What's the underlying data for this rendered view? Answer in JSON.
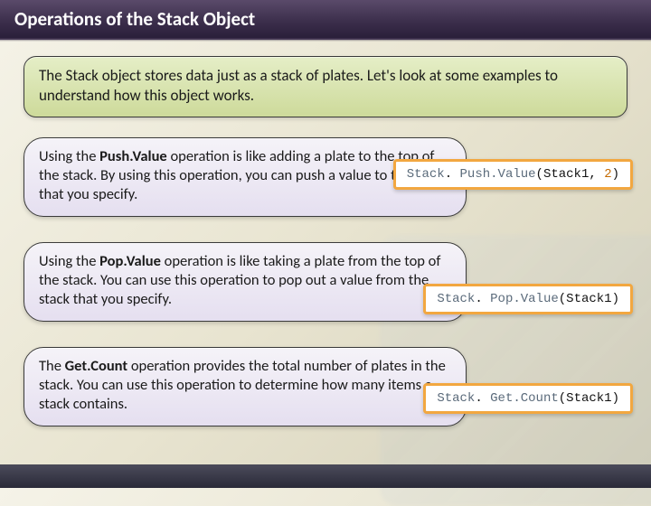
{
  "title": "Operations of the Stack Object",
  "intro": "The Stack object stores data just as a stack of plates. Let's look at some examples to understand how this object works.",
  "ops": [
    {
      "pre": "Using the ",
      "bold": "Push.Value",
      "post": " operation is like adding a plate to the top of the stack. By using this operation, you can push a value to the stack that you specify.",
      "code": {
        "cls": "Stack",
        "method": "Push.Value",
        "arg1": "Stack1",
        "arg2": "2"
      }
    },
    {
      "pre": "Using the ",
      "bold": "Pop.Value",
      "post": " operation is like taking a plate from the top of the stack. You can use this operation to pop out a value from the stack that you specify.",
      "code": {
        "cls": "Stack",
        "method": "Pop.Value",
        "arg1": "Stack1"
      }
    },
    {
      "pre": "The ",
      "bold": "Get.Count",
      "post": " operation provides the total number of plates in the stack. You can use this operation to determine how many items a stack contains.",
      "code": {
        "cls": "Stack",
        "method": "Get.Count",
        "arg1": "Stack1"
      }
    }
  ],
  "punct": {
    "dot": ". ",
    "lp": "(",
    "rp": ")",
    "comma": ", "
  }
}
